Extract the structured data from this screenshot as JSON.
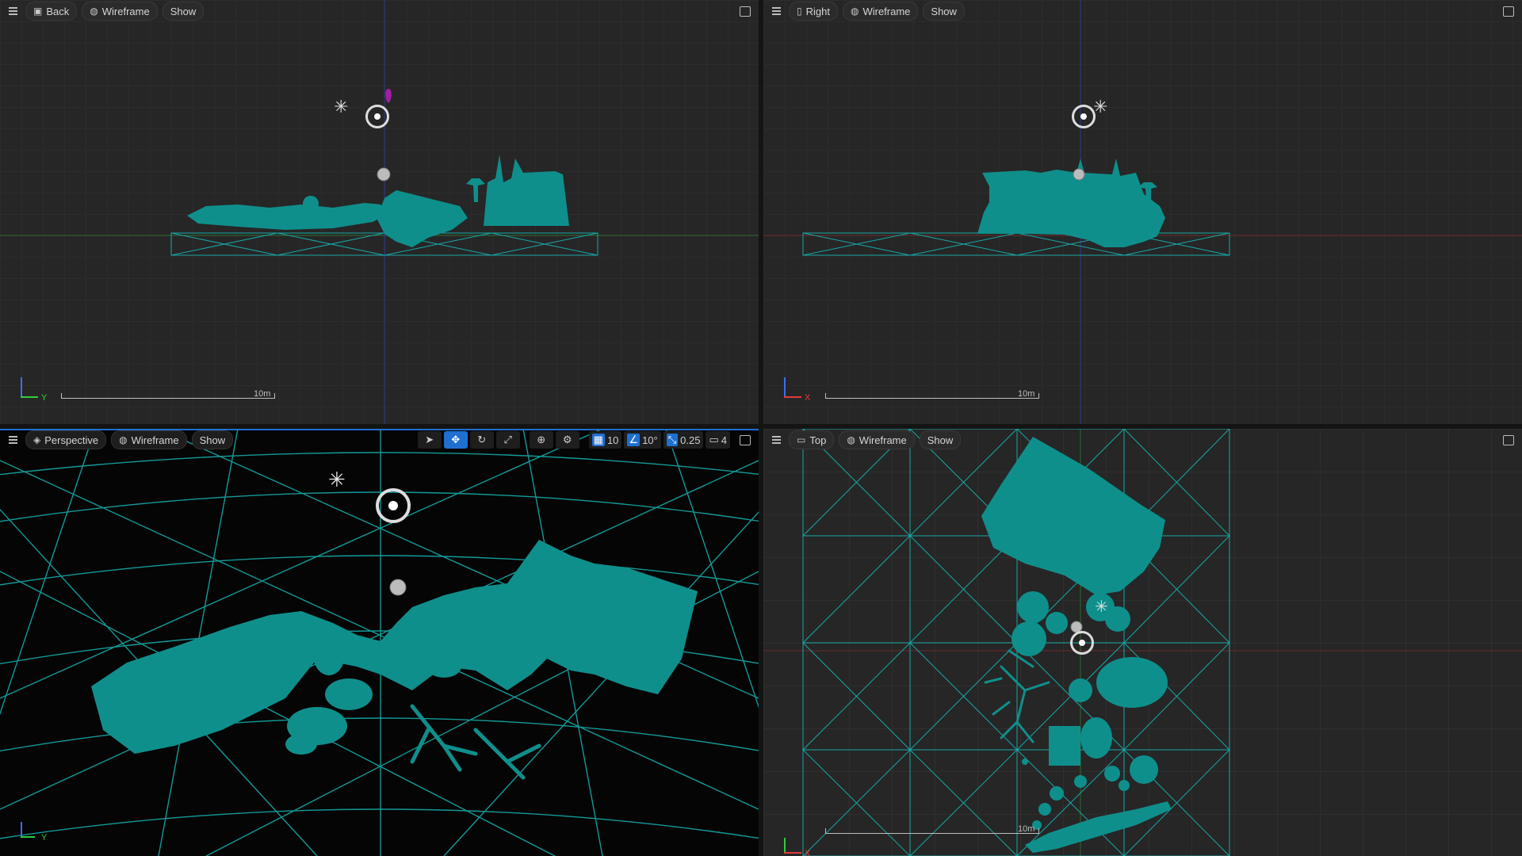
{
  "colors": {
    "mesh": "#0f8f8c",
    "wire": "#18a8a6",
    "accent": "#1f6fd1"
  },
  "viewports": {
    "back": {
      "view_label": "Back",
      "mode_label": "Wireframe",
      "show_label": "Show",
      "axis_label": "Y",
      "scale_label": "10m"
    },
    "right": {
      "view_label": "Right",
      "mode_label": "Wireframe",
      "show_label": "Show",
      "axis_label": "X",
      "scale_label": "10m"
    },
    "perspective": {
      "view_label": "Perspective",
      "mode_label": "Wireframe",
      "show_label": "Show",
      "axis_label": "Y",
      "grid_snap": "10",
      "rotation_snap": "10°",
      "scale_snap": "0.25",
      "camera_speed": "4"
    },
    "top": {
      "view_label": "Top",
      "mode_label": "Wireframe",
      "show_label": "Show",
      "axis_label": "X",
      "scale_label": "10m"
    }
  },
  "icons": {
    "menu": "hamburger-menu-icon",
    "maximize": "maximize-viewport-icon",
    "wireframe": "wireframe-sphere-icon",
    "select": "select-arrow-icon",
    "translate": "translate-icon",
    "rotate": "rotate-icon",
    "scale": "scale-icon",
    "world": "world-space-icon",
    "surface_snap": "surface-snap-icon",
    "grid_snap": "grid-snap-icon",
    "angle_snap": "angle-snap-icon",
    "scale_snap": "scale-snap-icon",
    "camera_speed": "camera-speed-icon",
    "directional_light": "directional-light-icon",
    "sky_light": "sky-light-icon",
    "sphere_reflection": "reflection-sphere-icon"
  }
}
